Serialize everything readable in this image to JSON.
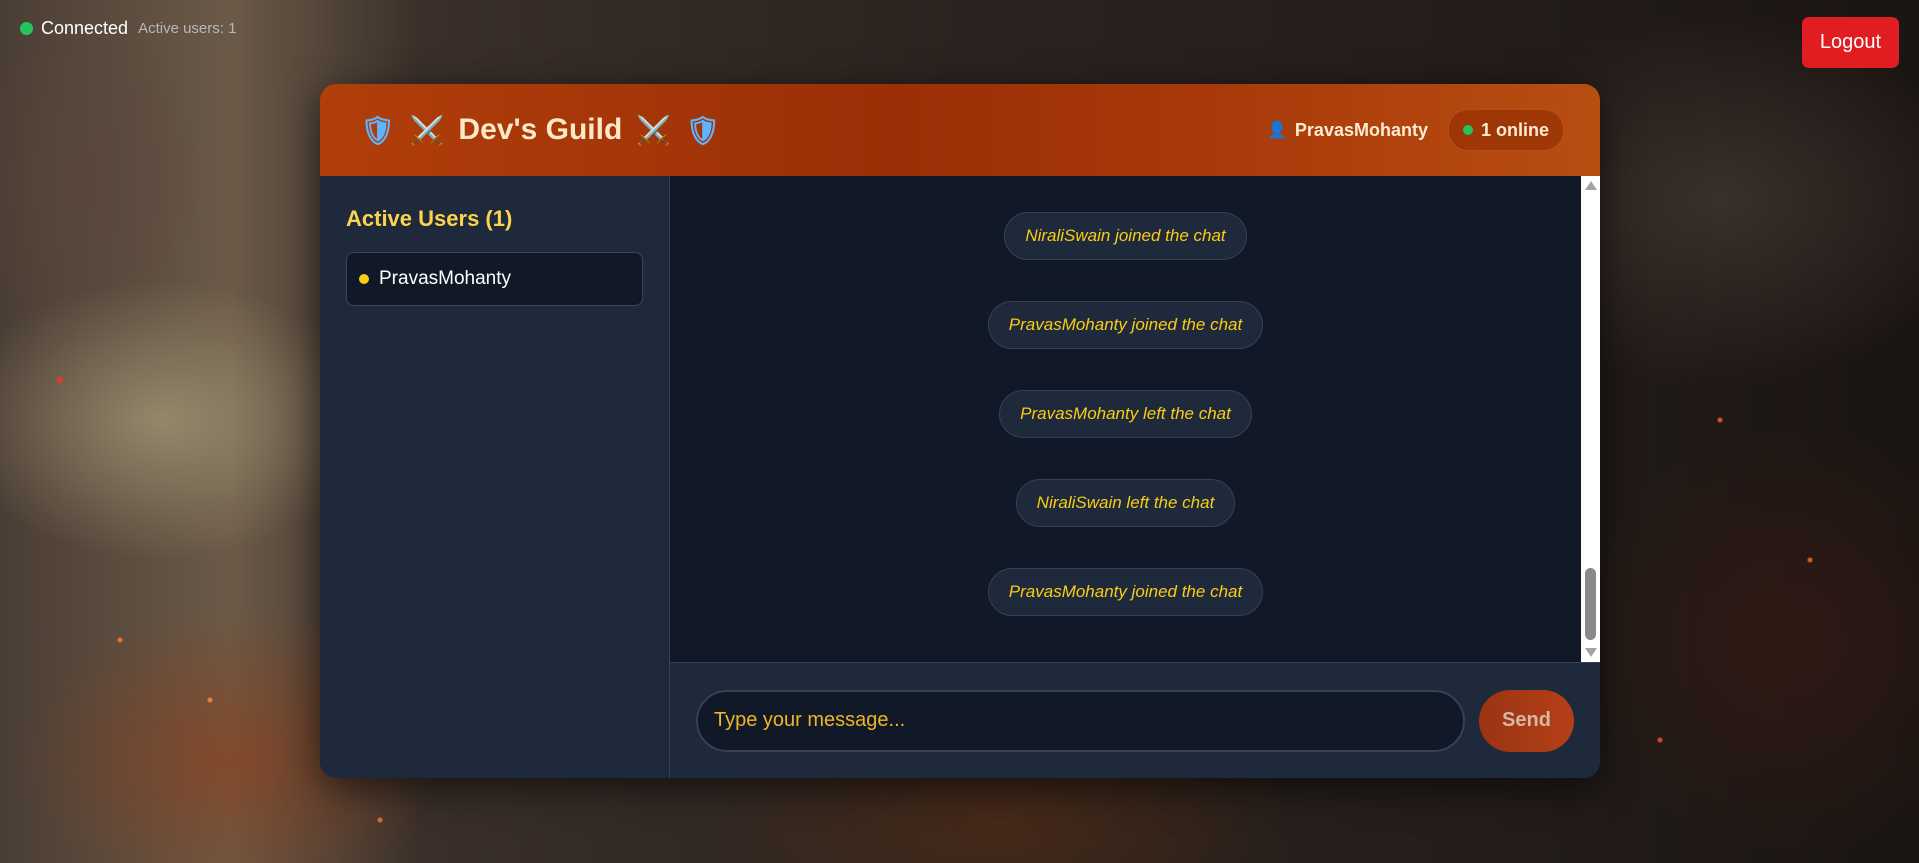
{
  "status": {
    "label": "Connected",
    "active_users_text": "Active users: 1"
  },
  "logout_label": "Logout",
  "header": {
    "shield_icon": "🛡",
    "swords_icon": "⚔️",
    "title": "Dev's Guild",
    "current_user": "PravasMohanty",
    "online_text": "1 online"
  },
  "sidebar": {
    "title": "Active Users (1)",
    "users": [
      "PravasMohanty"
    ]
  },
  "messages": [
    "NiraliSwain joined the chat",
    "PravasMohanty joined the chat",
    "PravasMohanty left the chat",
    "NiraliSwain left the chat",
    "PravasMohanty joined the chat"
  ],
  "composer": {
    "placeholder": "Type your message...",
    "send_label": "Send"
  },
  "colors": {
    "connected": "#22c55e",
    "logout": "#e11d22",
    "accent": "#facc15",
    "header_gradient": "#a9390a"
  }
}
